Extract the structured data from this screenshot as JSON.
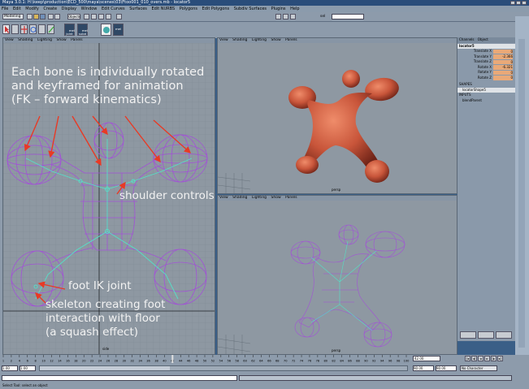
{
  "window": {
    "title": "Maya 3.0.1: H:\\keep\\production\\ECD_500\\maya\\scenes\\03\\Ftoo001_010_overs.mb   -  locator5"
  },
  "menus": [
    "File",
    "Edit",
    "Modify",
    "Create",
    "Display",
    "Window",
    "Edit Curves",
    "Surfaces",
    "Edit NURBS",
    "Polygons",
    "Edit Polygons",
    "Subdiv Surfaces",
    "Plugins",
    "Help"
  ],
  "toolbar": {
    "mode": "Modeling",
    "selection_field": "Objects",
    "search_value": "",
    "shelf_labels": [
      "mel\njoint",
      "mel\nsubd",
      "",
      "mel"
    ]
  },
  "viewports": [
    {
      "menu": [
        "View",
        "Shading",
        "Lighting",
        "Show",
        "Panels"
      ],
      "camera_label": "side"
    },
    {
      "menu": [
        "View",
        "Shading",
        "Lighting",
        "Show",
        "Panels"
      ],
      "camera_label": "persp"
    },
    {
      "menu": [
        "View",
        "Shading",
        "Lighting",
        "Show",
        "Panels"
      ],
      "camera_label": "persp"
    }
  ],
  "annotations": {
    "fk_line1": "Each bone is individually rotated",
    "fk_line2": "and keyframed for animation",
    "fk_line3": "(FK – forward kinematics)",
    "shoulder": "shoulder controls",
    "foot_ik": "foot IK joint",
    "skel_line1": "skeleton creating foot",
    "skel_line2": "interaction with floor",
    "skel_line3": "(a squash effect)"
  },
  "channel_box": {
    "tabs": [
      "Channels",
      "Object"
    ],
    "object_name": "locator5",
    "channels": [
      {
        "name": "Translate X",
        "value": "0"
      },
      {
        "name": "Translate Y",
        "value": "-2.366"
      },
      {
        "name": "Translate Z",
        "value": "0"
      },
      {
        "name": "Rotate X",
        "value": "-6.321"
      },
      {
        "name": "Rotate Y",
        "value": "0"
      },
      {
        "name": "Rotate Z",
        "value": "0"
      }
    ],
    "shapes_header": "SHAPES",
    "shape_name": "locatorShape5",
    "inputs_header": "INPUTS",
    "input_name": "blendParent"
  },
  "timeline": {
    "ticks": [
      "1",
      "2",
      "4",
      "6",
      "8",
      "10",
      "12",
      "14",
      "16",
      "18",
      "20",
      "22",
      "24",
      "26",
      "28",
      "30",
      "32",
      "34",
      "36",
      "38",
      "40",
      "42",
      "44",
      "46",
      "48",
      "50",
      "52",
      "54",
      "56",
      "58",
      "60",
      "62",
      "64",
      "66",
      "68",
      "70",
      "72",
      "74",
      "76",
      "78",
      "80",
      "82",
      "84",
      "86",
      "88",
      "90",
      "92",
      "94",
      "96",
      "98",
      "100"
    ],
    "current_frame": "42.00",
    "range_start": "1.00",
    "anim_start": "1.00",
    "range_end": "90.00",
    "anim_end": "90.00",
    "character": "No Character"
  },
  "help_line": "Select Tool: select an object",
  "colors": {
    "wireframe": "#a252d6",
    "skeleton": "#55e0c8",
    "arrow": "#e83a25",
    "shaded_model": "#c8553a",
    "viewport_bg": "#8e98a2",
    "channel_value": "#e9a978"
  }
}
